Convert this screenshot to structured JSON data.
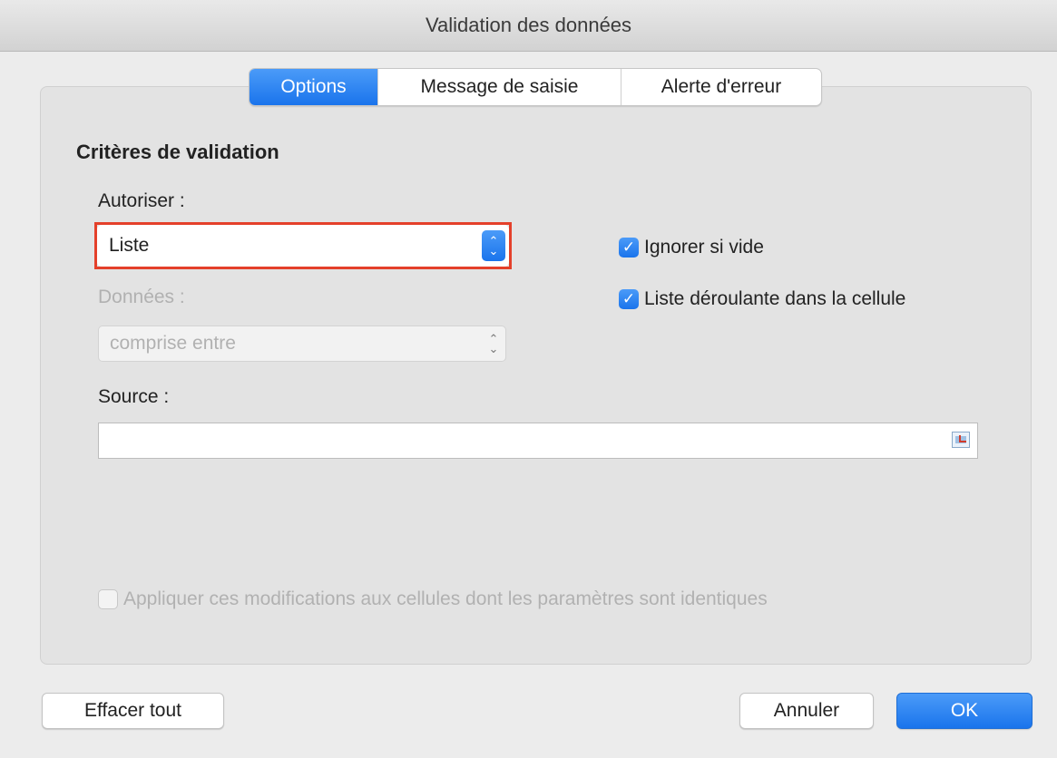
{
  "window": {
    "title": "Validation des données"
  },
  "tabs": [
    {
      "label": "Options",
      "active": true
    },
    {
      "label": "Message de saisie",
      "active": false
    },
    {
      "label": "Alerte d'erreur",
      "active": false
    }
  ],
  "criteria": {
    "title": "Critères de validation",
    "allow_label": "Autoriser :",
    "allow_value": "Liste",
    "data_label": "Données :",
    "data_value": "comprise entre",
    "source_label": "Source :",
    "source_value": ""
  },
  "options": {
    "ignore_blank": {
      "label": "Ignorer si vide",
      "checked": true
    },
    "in_cell_dropdown": {
      "label": "Liste déroulante dans la cellule",
      "checked": true
    },
    "apply_all": {
      "label": "Appliquer ces modifications aux cellules dont les paramètres sont identiques",
      "checked": false,
      "enabled": false
    }
  },
  "buttons": {
    "clear_all": "Effacer tout",
    "cancel": "Annuler",
    "ok": "OK"
  },
  "colors": {
    "accent": "#1a74ec",
    "focus_ring": "#e4402a",
    "disabled_text": "#b1b1b1"
  },
  "icons": {
    "stepper": "up-down-chevron-icon",
    "checkmark": "checkmark-icon",
    "range_picker": "range-select-icon"
  }
}
